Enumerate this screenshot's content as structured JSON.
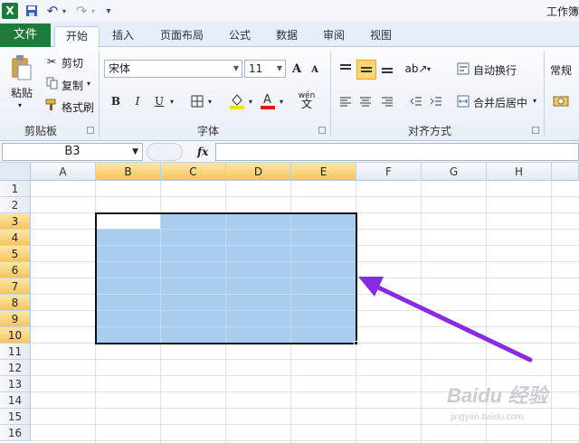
{
  "window": {
    "title": "工作簿"
  },
  "quick_access": {
    "excel_icon": "X",
    "save_icon": "save-icon",
    "undo_icon": "↶",
    "redo_icon": "↷",
    "customize_icon": "▾"
  },
  "tabs": [
    {
      "label": "文件"
    },
    {
      "label": "开始",
      "active": true
    },
    {
      "label": "插入"
    },
    {
      "label": "页面布局"
    },
    {
      "label": "公式"
    },
    {
      "label": "数据"
    },
    {
      "label": "审阅"
    },
    {
      "label": "视图"
    }
  ],
  "ribbon": {
    "clipboard": {
      "paste": "粘贴",
      "cut": "剪切",
      "copy": "复制",
      "format_painter": "格式刷",
      "group_label": "剪贴板"
    },
    "font": {
      "font_name": "宋体",
      "font_size": "11",
      "grow": "A",
      "shrink": "A",
      "bold": "B",
      "italic": "I",
      "underline": "U",
      "phonetic": "wén",
      "group_label": "字体"
    },
    "alignment": {
      "wrap_text": "自动换行",
      "merge_center": "合并后居中",
      "group_label": "对齐方式"
    },
    "number": {
      "format": "常规"
    }
  },
  "formula_bar": {
    "name_box": "B3",
    "fx_label": "fx",
    "value": ""
  },
  "sheet": {
    "columns": [
      "A",
      "B",
      "C",
      "D",
      "E",
      "F",
      "G",
      "H"
    ],
    "rows": [
      "1",
      "2",
      "3",
      "4",
      "5",
      "6",
      "7",
      "8",
      "9",
      "10",
      "11",
      "12",
      "13",
      "14",
      "15",
      "16"
    ],
    "selected_range": "B3:E10",
    "active_cell": "B3"
  },
  "colors": {
    "file_tab": "#1e7b3c",
    "selection_fill": "#a9cdee",
    "header_highlight": "#f7c55e",
    "arrow": "#8a2be2"
  },
  "watermark": {
    "logo": "Baidu 经验",
    "url": "jingyan.baidu.com"
  }
}
